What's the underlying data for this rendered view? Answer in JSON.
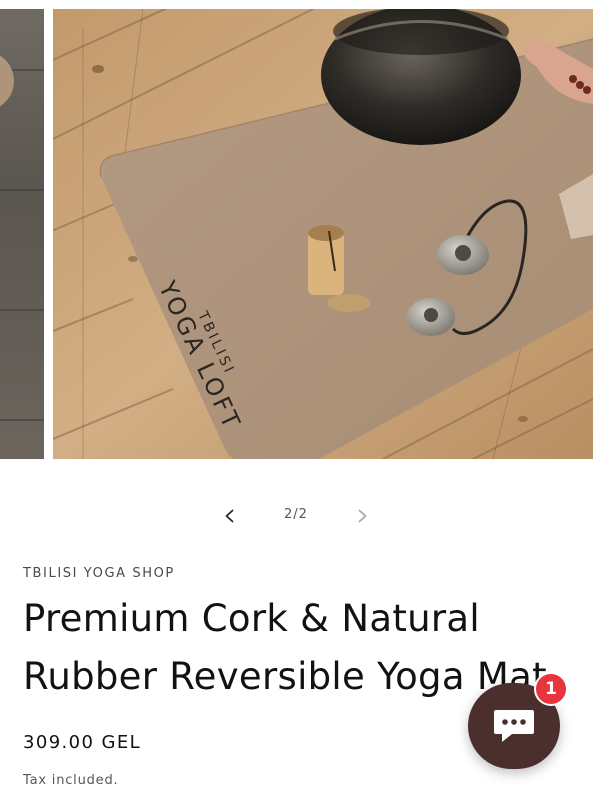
{
  "gallery": {
    "counter": "2/2",
    "current_slide": 2,
    "total_slides": 2,
    "image_print": {
      "line1": "TBILISI",
      "line2": "YOGA LOFT"
    }
  },
  "product": {
    "vendor": "TBILISI YOGA SHOP",
    "title": "Premium Cork & Natural Rubber Reversible Yoga Mat",
    "title_line1": "Premium Cork & Natural",
    "title_line2": "Rubber Reversible Yoga Mat",
    "price": "309.00 GEL",
    "tax_note": "Tax included."
  },
  "chat": {
    "badge_count": "1",
    "button_color": "#4a2f2d",
    "badge_color": "#e8343f"
  },
  "icons": {
    "prev": "chevron-left-icon",
    "next": "chevron-right-icon",
    "chat": "chat-bubble-icon"
  }
}
